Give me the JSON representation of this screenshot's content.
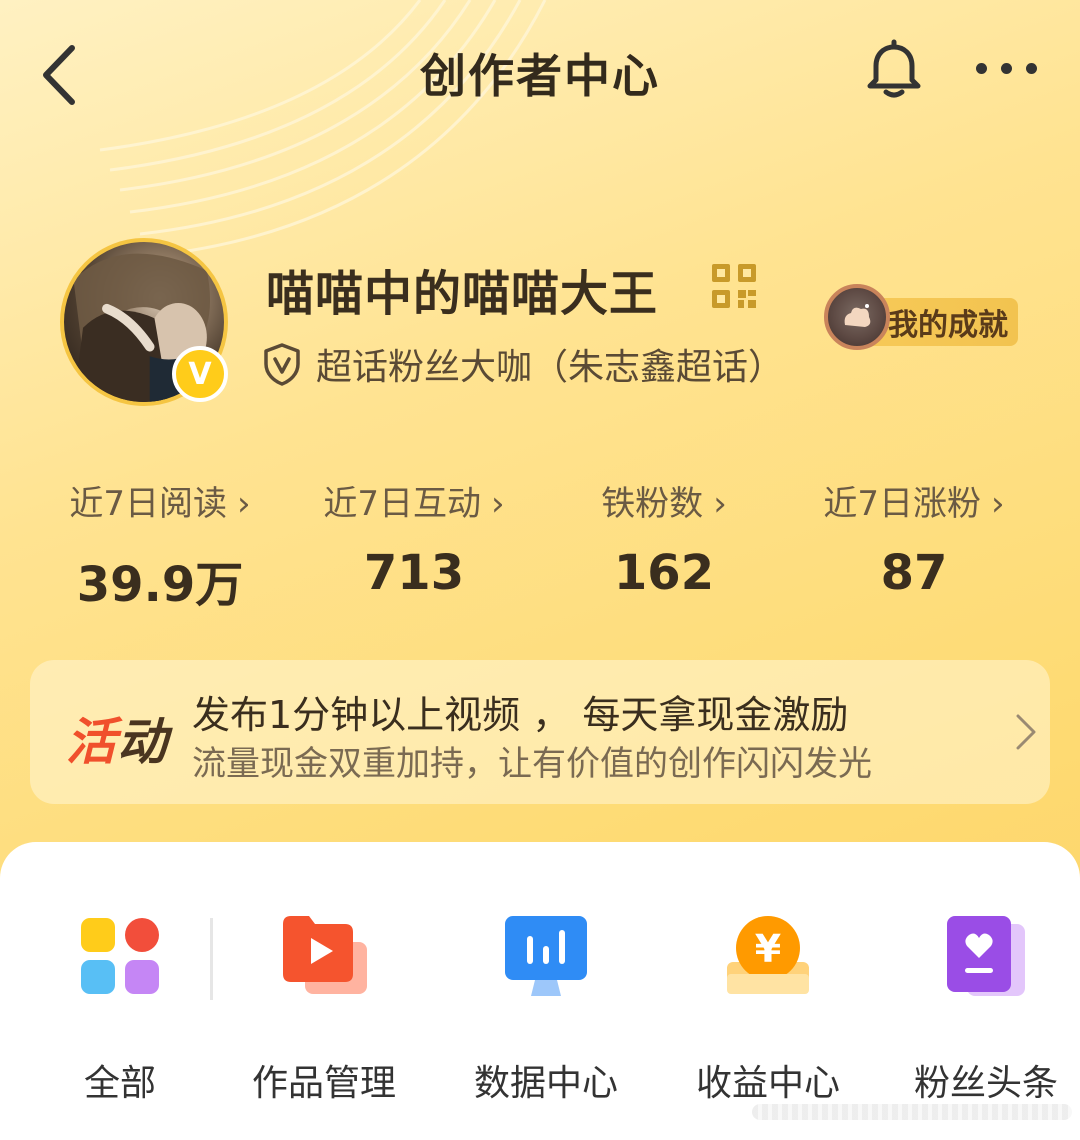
{
  "header": {
    "title": "创作者中心"
  },
  "profile": {
    "name": "喵喵中的喵喵大王",
    "fan_title": "超话粉丝大咖（朱志鑫超话）",
    "achievement_label": "我的成就"
  },
  "stats": [
    {
      "label": "近7日阅读",
      "value": "39.9万"
    },
    {
      "label": "近7日互动",
      "value": "713"
    },
    {
      "label": "铁粉数",
      "value": "162"
    },
    {
      "label": "近7日涨粉",
      "value": "87"
    }
  ],
  "activity": {
    "tag_part1": "活",
    "tag_part2": "动",
    "title": "发布1分钟以上视频 ， 每天拿现金激励",
    "subtitle": "流量现金双重加持，让有价值的创作闪闪发光"
  },
  "tools": [
    {
      "label": "全部",
      "icon": "all-apps-icon"
    },
    {
      "label": "作品管理",
      "icon": "works-manage-icon"
    },
    {
      "label": "数据中心",
      "icon": "data-center-icon"
    },
    {
      "label": "收益中心",
      "icon": "income-center-icon"
    },
    {
      "label": "粉丝头条",
      "icon": "fan-headline-icon"
    }
  ],
  "colors": {
    "background": "#fedb74",
    "accent_red": "#f0502c",
    "badge_yellow": "#ffcc1a",
    "qr_gold": "#c89a2a"
  }
}
